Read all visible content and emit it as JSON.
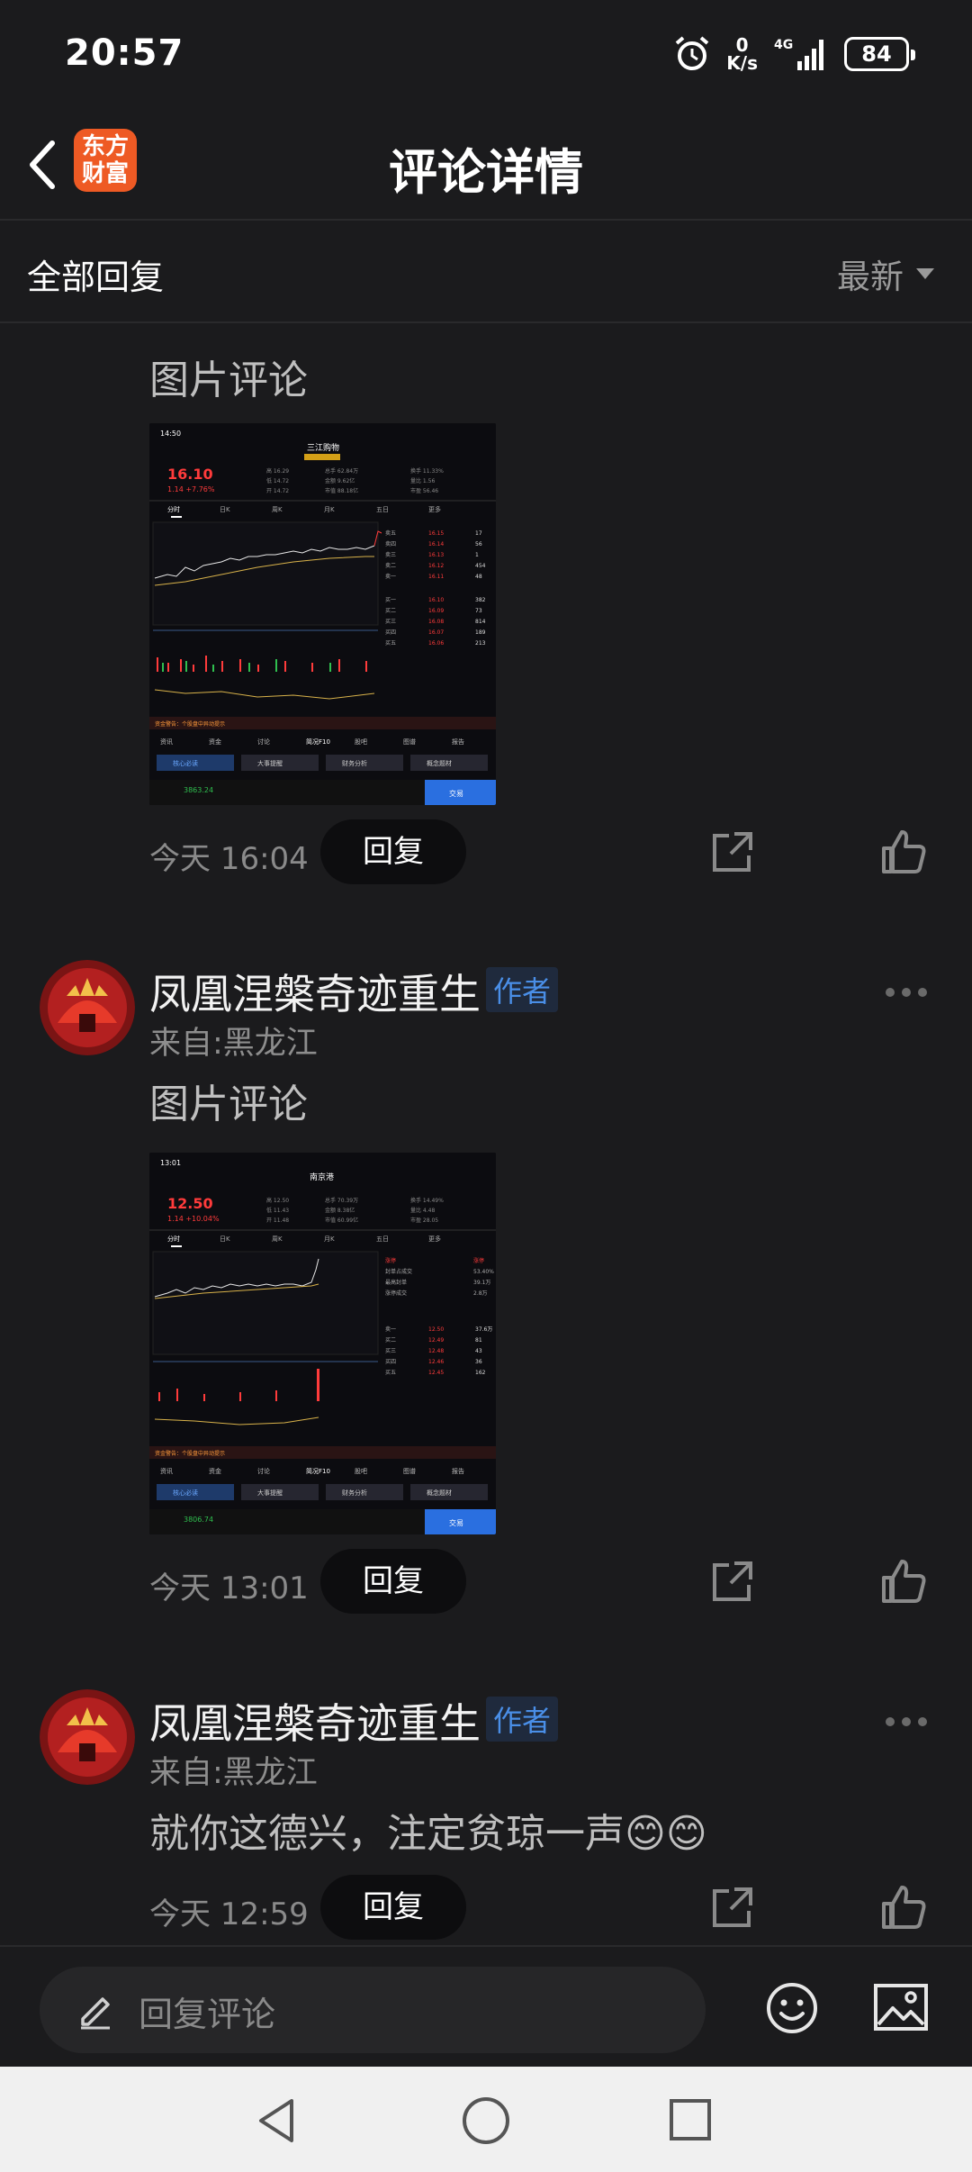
{
  "status_bar": {
    "time": "20:57",
    "speed_value": "0",
    "speed_unit": "K/s",
    "network": "4G",
    "battery": "84"
  },
  "header": {
    "title": "评论详情",
    "logo_text": "东方财富",
    "logo_color": "#ee5a24"
  },
  "filter": {
    "title": "全部回复",
    "sort_label": "最新"
  },
  "comments": [
    {
      "text": "图片评论",
      "time": "今天 16:04",
      "reply_label": "回复",
      "screenshot": {
        "clock": "14:50",
        "stock_name": "三江购物",
        "price": "16.10",
        "change": "1.14 +7.76%",
        "tabs": [
          "分时",
          "日K",
          "周K",
          "月K",
          "五日",
          "更多"
        ],
        "quotes": [
          [
            "卖五",
            "16.15",
            "17"
          ],
          [
            "卖四",
            "16.14",
            "56"
          ],
          [
            "卖三",
            "16.13",
            "1"
          ],
          [
            "卖二",
            "16.12",
            "454"
          ],
          [
            "卖一",
            "16.11",
            "48"
          ],
          [
            "买一",
            "16.10",
            "382"
          ],
          [
            "买二",
            "16.09",
            "73"
          ],
          [
            "买三",
            "16.08",
            "814"
          ],
          [
            "买四",
            "16.07",
            "189"
          ],
          [
            "买五",
            "16.06",
            "213"
          ]
        ],
        "index_value": "3863.24",
        "bottom_tabs": [
          "资讯",
          "资金",
          "讨论",
          "简况F10",
          "股吧",
          "图谱",
          "报告"
        ],
        "buttons": [
          "核心必读",
          "大事提醒",
          "财务分析",
          "概念题材"
        ],
        "trade_label": "交易"
      }
    },
    {
      "user": "凤凰涅槃奇迹重生",
      "badge": "作者",
      "location": "来自:黑龙江",
      "text": "图片评论",
      "time": "今天 13:01",
      "reply_label": "回复",
      "screenshot": {
        "clock": "13:01",
        "stock_name": "南京港",
        "price": "12.50",
        "change": "1.14 +10.04%",
        "tabs": [
          "分时",
          "日K",
          "周K",
          "月K",
          "五日",
          "更多"
        ],
        "quotes": [
          [
            "卖一",
            "12.50",
            "37.6万"
          ],
          [
            "买二",
            "12.49",
            "81"
          ],
          [
            "买三",
            "12.48",
            "43"
          ],
          [
            "买四",
            "12.46",
            "36"
          ],
          [
            "买五",
            "12.45",
            "162"
          ]
        ],
        "index_value": "3806.74",
        "bottom_tabs": [
          "资讯",
          "资金",
          "讨论",
          "简况F10",
          "股吧",
          "图谱",
          "报告"
        ],
        "buttons": [
          "核心必读",
          "大事提醒",
          "财务分析",
          "概念题材"
        ],
        "trade_label": "交易"
      }
    },
    {
      "user": "凤凰涅槃奇迹重生",
      "badge": "作者",
      "location": "来自:黑龙江",
      "text": "就你这德兴，注定贫琼一声",
      "emoji": "😊😊",
      "time": "今天 12:59",
      "reply_label": "回复"
    }
  ],
  "bottom": {
    "placeholder": "回复评论"
  }
}
